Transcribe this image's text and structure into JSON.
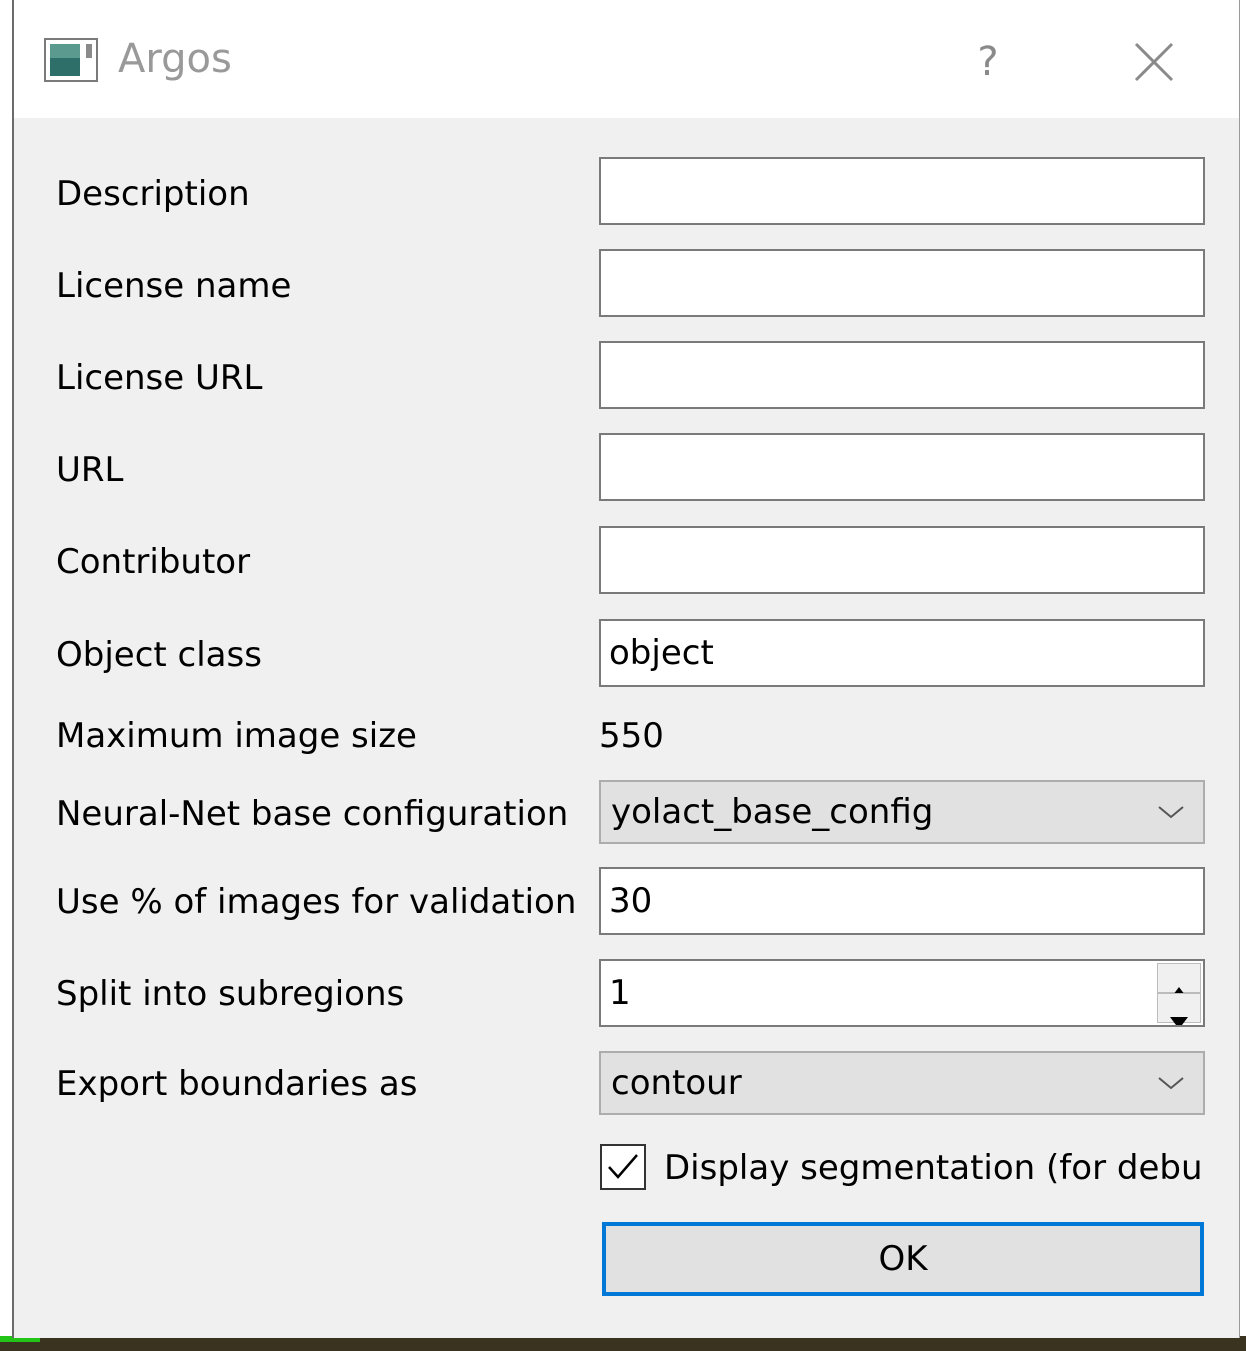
{
  "window": {
    "title": "Argos",
    "help_label": "?",
    "app_icon": "window-app-icon",
    "close_icon": "close-icon"
  },
  "form": {
    "description": {
      "label": "Description",
      "value": ""
    },
    "license_name": {
      "label": "License name",
      "value": ""
    },
    "license_url": {
      "label": "License URL",
      "value": ""
    },
    "url": {
      "label": "URL",
      "value": ""
    },
    "contributor": {
      "label": "Contributor",
      "value": ""
    },
    "object_class": {
      "label": "Object class",
      "value": "object"
    },
    "max_image_size": {
      "label": "Maximum image size",
      "value": "550"
    },
    "nn_base_config": {
      "label": "Neural-Net base configuration",
      "value": "yolact_base_config"
    },
    "validation_percent": {
      "label": "Use % of images for validation",
      "value": "30"
    },
    "subregions": {
      "label": "Split into subregions",
      "value": "1"
    },
    "export_boundaries": {
      "label": "Export boundaries as",
      "value": "contour"
    },
    "display_segmentation": {
      "label": "Display segmentation (for debug)",
      "checked": true
    }
  },
  "buttons": {
    "ok": "OK"
  },
  "colors": {
    "dialog_bg": "#f0f0f0",
    "focus_border": "#0078d7",
    "combo_bg": "#e1e1e1"
  }
}
